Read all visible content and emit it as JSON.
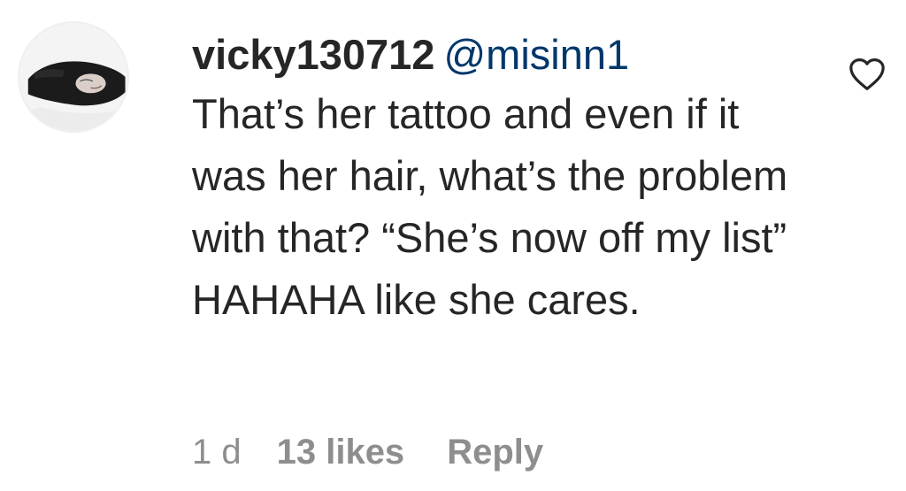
{
  "comment": {
    "username": "vicky130712",
    "mention": "@misinn1",
    "text": "That’s her tattoo and even if it was her hair, what’s the problem with that? “She’s now off my list” HAHAHA like she cares.",
    "time": "1 d",
    "likes": "13 likes",
    "reply_label": "Reply",
    "like_icon": "heart-outline-icon",
    "avatar": "user-avatar"
  },
  "colors": {
    "text": "#262626",
    "mention": "#00376b",
    "meta": "#8e8e8e"
  }
}
